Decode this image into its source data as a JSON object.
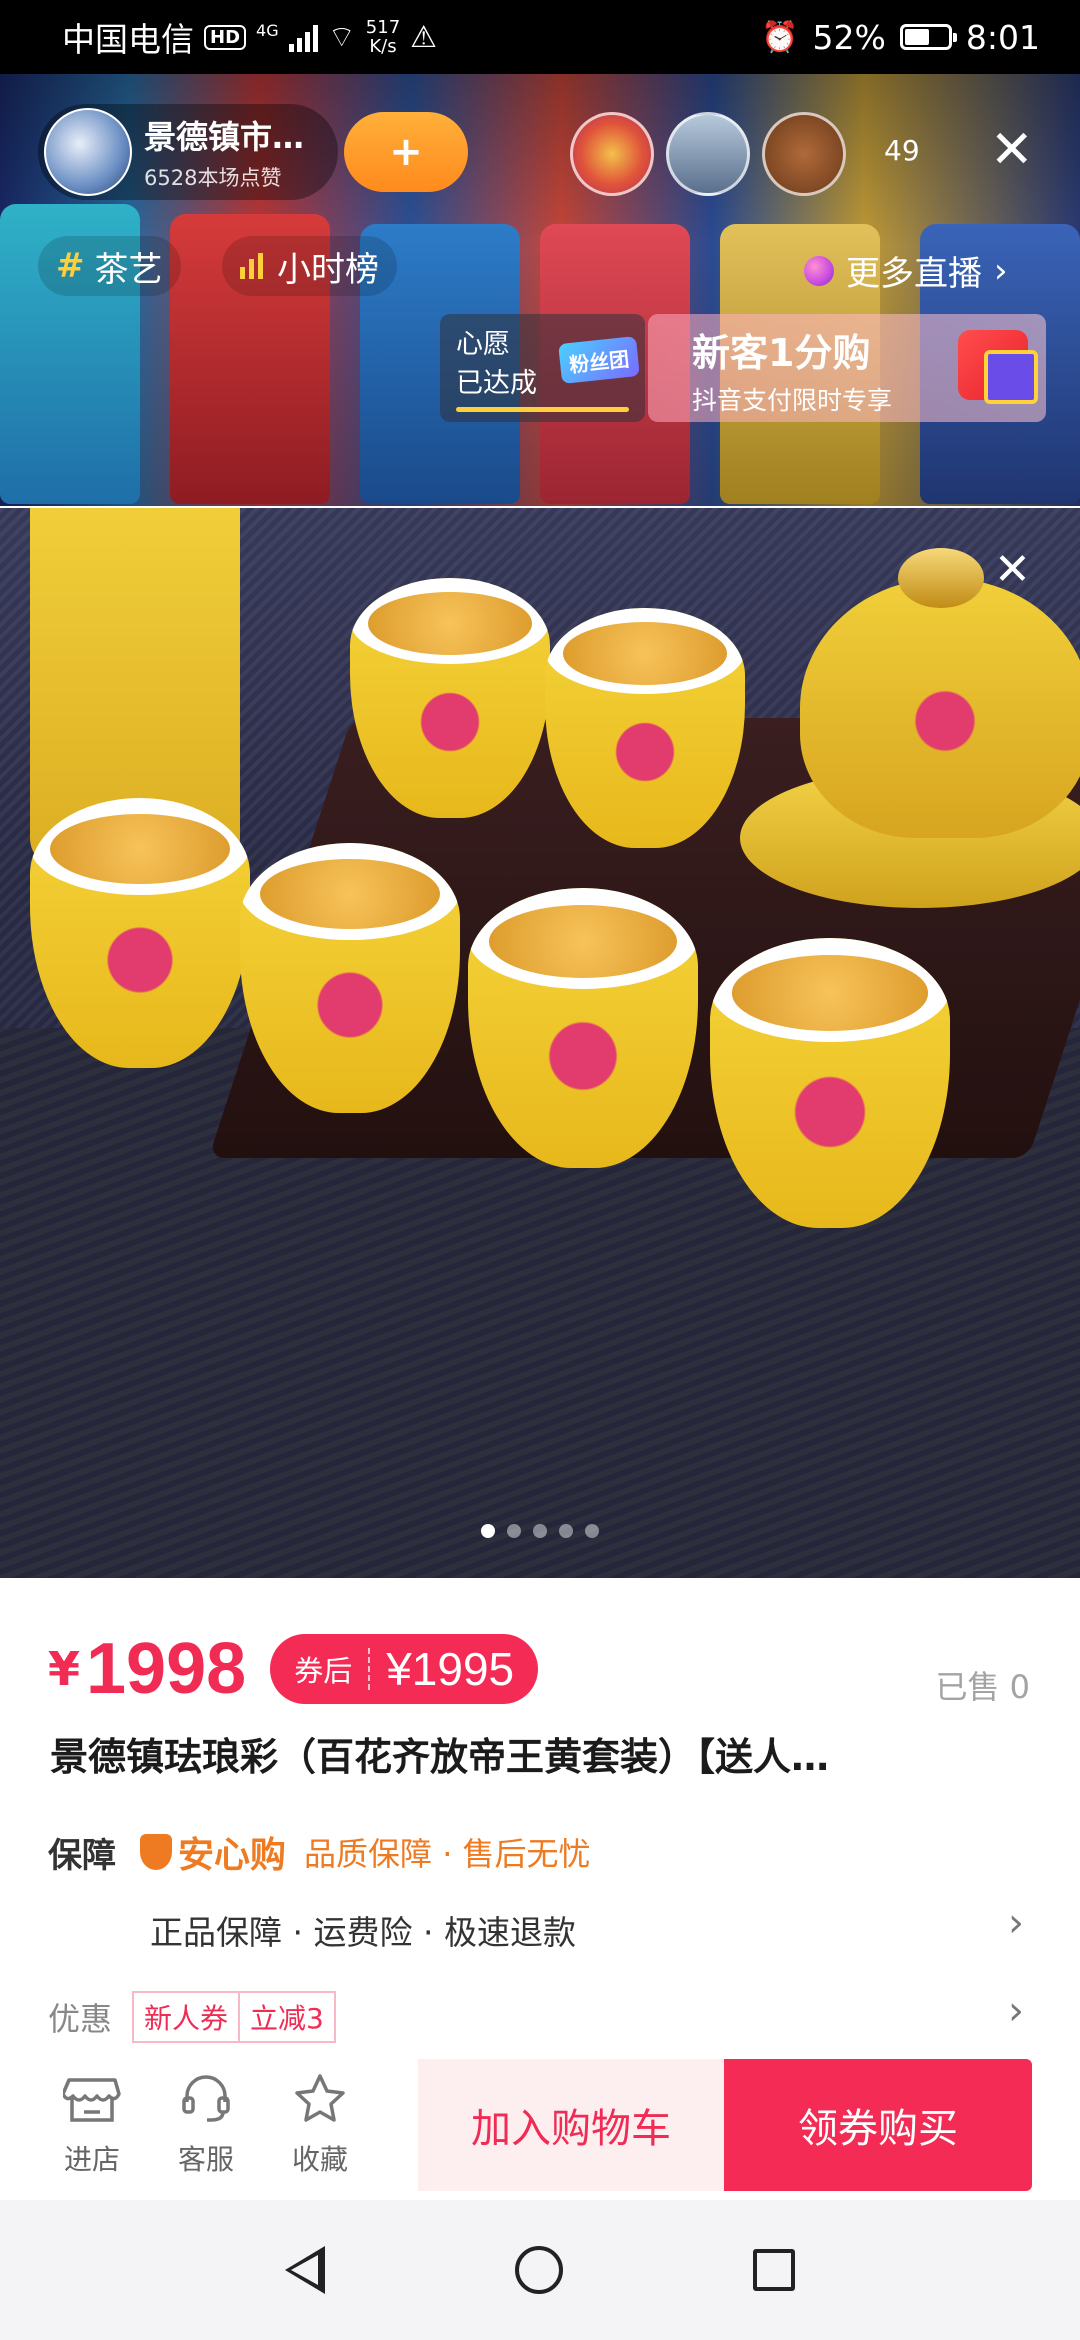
{
  "status_bar": {
    "carrier": "中国电信",
    "hd": "HD",
    "network": "4G",
    "speed_value": "517",
    "speed_unit": "K/s",
    "battery": "52%",
    "battery_level": 0.52,
    "time": "8:01"
  },
  "live": {
    "host_name": "景德镇市…",
    "host_likes": "6528本场点赞",
    "follow_icon": "+",
    "viewer_count": "49",
    "close_icon": "✕",
    "tags": [
      {
        "label": "茶艺",
        "icon": "#"
      },
      {
        "label": "小时榜",
        "icon": "bars-icon"
      }
    ],
    "more_live": "更多直播",
    "wish": {
      "line1": "心愿",
      "line2": "已达成"
    },
    "fans_badge": "粉丝团",
    "promo": {
      "title": "新客1分购",
      "subtitle": "抖音支付限时专享"
    }
  },
  "product_image": {
    "close_icon": "✕",
    "carousel_count": 5,
    "carousel_active": 0
  },
  "product": {
    "currency": "¥",
    "price": "1998",
    "coupon_label": "券后",
    "coupon_price": "¥1995",
    "sold": "已售 0",
    "title": "景德镇珐琅彩（百花齐放帝王黄套装）【送人…",
    "guarantee_label": "保障",
    "anxin": "安心购",
    "guarantee_tags": "品质保障 · 售后无忧",
    "guarantee_sub": "正品保障 · 运费险 · 极速退款",
    "youhui_label": "优惠",
    "youhui_tags": [
      "新人券",
      "立减3"
    ],
    "chevron": "›"
  },
  "actions": {
    "store": "进店",
    "service": "客服",
    "favorite": "收藏",
    "add_cart": "加入购物车",
    "buy": "领券购买"
  },
  "colors": {
    "accent": "#f42b54",
    "orange": "#ee7a22"
  }
}
